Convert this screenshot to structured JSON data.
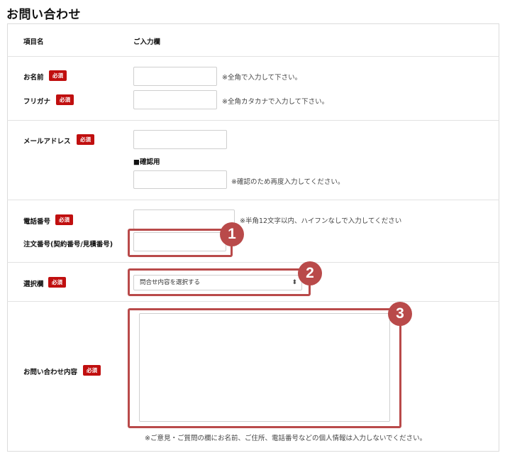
{
  "page_title": "お問い合わせ",
  "header": {
    "col_label": "項目名",
    "col_input": "ご入力欄"
  },
  "required_label": "必須",
  "fields": {
    "name": {
      "label": "お名前",
      "value": "",
      "note": "※全角で入力して下さい。"
    },
    "furigana": {
      "label": "フリガナ",
      "value": "",
      "note": "※全角カタカナで入力して下さい。"
    },
    "email": {
      "label": "メールアドレス",
      "value": ""
    },
    "email_confirm": {
      "label": "■確認用",
      "value": "",
      "note": "※確認のため再度入力してください。"
    },
    "phone": {
      "label": "電話番号",
      "value": "",
      "note": "※半角12文字以内、ハイフンなしで入力してください"
    },
    "order_no": {
      "label": "注文番号(契約番号/見積番号)",
      "value": ""
    },
    "select": {
      "label": "選択欄",
      "selected": "問合せ内容を選択する"
    },
    "inquiry": {
      "label": "お問い合わせ内容",
      "value": ""
    }
  },
  "footer_note": "※ご意見・ご質問の欄にお名前、ご住所、電話番号などの個人情報は入力しないでください。",
  "annotations": [
    "1",
    "2",
    "3"
  ],
  "colors": {
    "required_badge": "#c00f0f",
    "highlight": "#b94a4a"
  }
}
